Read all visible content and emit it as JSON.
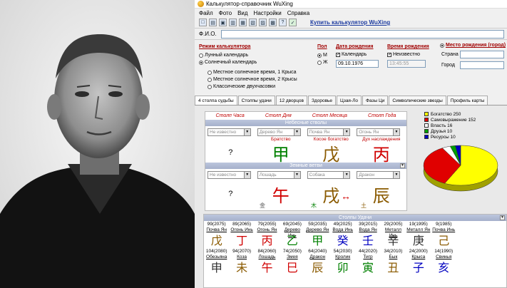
{
  "window": {
    "title": "Калькулятор-справочник WuXing"
  },
  "menu": [
    "Файл",
    "Фото",
    "Вид",
    "Настройки",
    "Справка"
  ],
  "toolbar": {
    "buy_link": "Купить калькулятор WuXing",
    "icons": [
      "new-icon",
      "open-icon",
      "save-icon",
      "print-icon",
      "copy-icon",
      "doc-icon",
      "calendar-icon",
      "book-icon",
      "help-icon",
      "exit-icon"
    ]
  },
  "fio": {
    "label": "Ф.И.О.",
    "value": ""
  },
  "calendar": {
    "label": "Режим калькулятора",
    "lunar": "Лунный календарь",
    "solar": "Солнечный календарь",
    "local1": "Местное солнечное время, 1 Крыса",
    "local2": "Местное солнечное время, 2 Крысы",
    "classic": "Классические двухчасовки"
  },
  "sex": {
    "label": "Пол",
    "m": "М",
    "f": "Ж"
  },
  "birth_date": {
    "label": "Дата рождения",
    "calendar_chk": "Календарь",
    "value": "09.10.1976"
  },
  "birth_time": {
    "label": "Время рождения",
    "unknown_chk": "Неизвестно",
    "value": "13:45:55"
  },
  "birth_place": {
    "label": "Место рождения (город)",
    "country": "Страна",
    "city": "Город"
  },
  "tabs": [
    "4 столпа судьбы",
    "Столпы удачи",
    "12 дворцов",
    "Здоровье",
    "Цзая-Ло",
    "Фазы Ци",
    "Символические звезды",
    "Профиль карты"
  ],
  "pillars": {
    "headers": [
      "Столп Часа",
      "Столп Дня",
      "Столп Месяца",
      "Столп Года"
    ],
    "stems_bar": "Небесные стволы",
    "stem_selects": [
      "Не известно",
      "Дерево Ян",
      "Почва Ян",
      "Огонь Ян"
    ],
    "stem_notes": [
      "",
      "Братство",
      "Косое богатство",
      "Дух наслаждения"
    ],
    "stem_glyphs": [
      "?",
      "甲",
      "戊",
      "丙"
    ],
    "branches_bar": "Земные ветви",
    "branch_selects": [
      "Не известно",
      "Лошадь",
      "Собака",
      "Дракон"
    ],
    "branch_glyphs": [
      "?",
      "午",
      "戌",
      "辰"
    ],
    "hidden": {
      "metal": "金",
      "wood": "木",
      "earth": "土"
    },
    "clash_arrow": "↔"
  },
  "legend": [
    {
      "label": "Богатство",
      "value": "250",
      "color": "#ffff00"
    },
    {
      "label": "Самовыражение",
      "value": "152",
      "color": "#e00000"
    },
    {
      "label": "Власть",
      "value": "16",
      "color": "#ffffff"
    },
    {
      "label": "Друзья",
      "value": "10",
      "color": "#00a000"
    },
    {
      "label": "Ресурсы",
      "value": "10",
      "color": "#0000c0"
    }
  ],
  "luck": {
    "bar": "Столпы Удачи",
    "top_years": [
      "99(2075)",
      "89(2065)",
      "79(2055)",
      "69(2045)",
      "59(2035)",
      "49(2025)",
      "39(2015)",
      "29(2005)",
      "19(1995)",
      "9(1985)"
    ],
    "stem_names": [
      "Почва Ян",
      "Огонь Инь",
      "Огонь Ян",
      "Дерево Инь",
      "Дерево Ян",
      "Вода Инь",
      "Вода Ян",
      "Металл Инь",
      "Металл Ян",
      "Почва Инь"
    ],
    "stem_glyphs": [
      "戊",
      "丁",
      "丙",
      "乙",
      "甲",
      "癸",
      "壬",
      "辛",
      "庚",
      "己"
    ],
    "stem_colors": [
      "#8a5a00",
      "#d00000",
      "#d00000",
      "#008000",
      "#008000",
      "#0000c0",
      "#0000c0",
      "#303030",
      "#303030",
      "#8a5a00"
    ],
    "bottom_years": [
      "104(2080)",
      "94(2070)",
      "84(2060)",
      "74(2050)",
      "64(2040)",
      "54(2030)",
      "44(2020)",
      "34(2010)",
      "24(2000)",
      "14(1990)"
    ],
    "branch_names": [
      "Обезьяна",
      "Коза",
      "Лошадь",
      "Змея",
      "Дракон",
      "Кролик",
      "Тигр",
      "Бык",
      "Крыса",
      "Свинья"
    ],
    "branch_glyphs": [
      "申",
      "未",
      "午",
      "巳",
      "辰",
      "卯",
      "寅",
      "丑",
      "子",
      "亥"
    ],
    "branch_colors": [
      "#303030",
      "#8a5a00",
      "#d00000",
      "#d00000",
      "#8a5a00",
      "#008000",
      "#008000",
      "#8a5a00",
      "#0000c0",
      "#0000c0"
    ]
  }
}
